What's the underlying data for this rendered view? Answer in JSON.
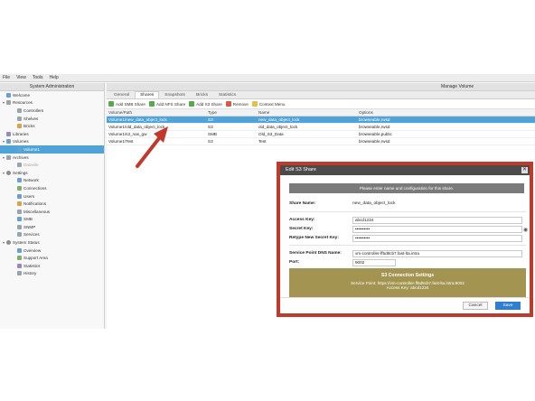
{
  "menu": [
    "File",
    "View",
    "Tools",
    "Help"
  ],
  "sidebar": {
    "title": "System Administration",
    "items": [
      {
        "label": "Welcome",
        "indent": 0,
        "icon": "home-icon"
      },
      {
        "label": "Resources",
        "indent": 0,
        "icon": "resources-icon",
        "toggle": "▾"
      },
      {
        "label": "Controllers",
        "indent": 1,
        "icon": "controller-icon"
      },
      {
        "label": "Shelves",
        "indent": 1,
        "icon": "shelf-icon"
      },
      {
        "label": "Bricks",
        "indent": 1,
        "icon": "brick-icon"
      },
      {
        "label": "Libraries",
        "indent": 0,
        "icon": "library-icon"
      },
      {
        "label": "Volumes",
        "indent": 0,
        "icon": "volume-icon",
        "toggle": "▾"
      },
      {
        "label": "Volume1",
        "indent": 1,
        "icon": "volume-icon",
        "selected": true
      },
      {
        "label": "Archives",
        "indent": 0,
        "icon": "archive-icon",
        "toggle": "▾"
      },
      {
        "label": "Datavile",
        "indent": 1,
        "icon": "archive-icon",
        "disabled": true
      },
      {
        "label": "Settings",
        "indent": 0,
        "icon": "settings-icon",
        "toggle": "▾"
      },
      {
        "label": "Network",
        "indent": 1,
        "icon": "network-icon"
      },
      {
        "label": "Connections",
        "indent": 1,
        "icon": "connection-icon"
      },
      {
        "label": "Users",
        "indent": 1,
        "icon": "users-icon"
      },
      {
        "label": "Notifications",
        "indent": 1,
        "icon": "notification-icon"
      },
      {
        "label": "Miscellaneous",
        "indent": 1,
        "icon": "misc-icon"
      },
      {
        "label": "SMB",
        "indent": 1,
        "icon": "smb-icon"
      },
      {
        "label": "SNMP",
        "indent": 1,
        "icon": "snmp-icon"
      },
      {
        "label": "Services",
        "indent": 1,
        "icon": "services-icon"
      },
      {
        "label": "System Status",
        "indent": 0,
        "icon": "status-icon",
        "toggle": "▾"
      },
      {
        "label": "Overview",
        "indent": 1,
        "icon": "overview-icon"
      },
      {
        "label": "Support Area",
        "indent": 1,
        "icon": "support-icon"
      },
      {
        "label": "Statistics",
        "indent": 1,
        "icon": "statistics-icon"
      },
      {
        "label": "History",
        "indent": 1,
        "icon": "history-icon"
      }
    ]
  },
  "main": {
    "title": "Manage Volume",
    "tabs": [
      "General",
      "Shares",
      "Snapshots",
      "Bricks",
      "Statistics"
    ],
    "active_tab": 1,
    "toolbar": [
      "Add SMB Share",
      "Add NFS Share",
      "Add S3 Share",
      "Remove",
      "Context Menu"
    ],
    "columns": [
      "Volume/Path",
      "Type",
      "Name",
      "Options"
    ],
    "rows": [
      {
        "path": "Volume1/new_data_object_lock",
        "type": "S3",
        "name": "new_data_object_lock",
        "options": "browseable,rwsd",
        "selected": true
      },
      {
        "path": "Volume1/old_data_object_lock",
        "type": "S3",
        "name": "old_data_object_lock",
        "options": "browseable,rwsd"
      },
      {
        "path": "Volume1/s3_nas_gw",
        "type": "SMB",
        "name": "Old_S3_Data",
        "options": "browseable,public"
      },
      {
        "path": "Volume1/Test",
        "type": "S3",
        "name": "Test",
        "options": "browseable,rwsd"
      }
    ]
  },
  "dialog": {
    "title": "Edit S3 Share",
    "close": "✕",
    "banner": "Please enter name and configuration for this share.",
    "share_name_label": "Share Name:",
    "share_name": "new_data_object_lock",
    "access_key_label": "Access Key:",
    "access_key": "abcd1234",
    "secret_key_label": "Secret Key:",
    "secret_key": "••••••••••",
    "retype_label": "Retype New Secret Key:",
    "retype_key": "••••••••••",
    "dns_label": "Service Point DNS Name:",
    "dns": "vm-controller-ff5d8cb7.fast-lta.intra",
    "port_label": "Port:",
    "port": "9002",
    "conn_title": "S3 Connection Settings",
    "conn_service_point": "Service Point: https://vm-controller-ff5d8cb7.fast-lta.intra:9002",
    "conn_access_key": "Access Key: abcd1234",
    "cancel": "Cancel",
    "save": "Save"
  },
  "colors": {
    "accent": "#4ea3d8",
    "highlight_border": "#c0392b",
    "arrow": "#c0392b",
    "save": "#2f7fd1",
    "info_box": "#a39551"
  }
}
